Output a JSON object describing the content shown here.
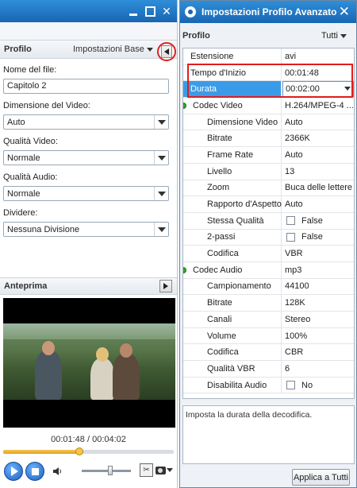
{
  "left_panel": {
    "profile_label": "Profilo",
    "profile_mode": "Impostazioni Base",
    "fields": {
      "filename_label": "Nome del file:",
      "filename_value": "Capitolo 2",
      "video_size_label": "Dimensione del Video:",
      "video_size_value": "Auto",
      "video_quality_label": "Qualità Video:",
      "video_quality_value": "Normale",
      "audio_quality_label": "Qualità Audio:",
      "audio_quality_value": "Normale",
      "split_label": "Dividere:",
      "split_value": "Nessuna Divisione"
    },
    "preview_label": "Anteprima",
    "timecode": "00:01:48 / 00:04:02",
    "progress_fraction": 0.447,
    "volume_fraction": 0.58
  },
  "dialog": {
    "title": "Impostazioni Profilo Avanzato",
    "profile_label": "Profilo",
    "profile_filter": "Tutti",
    "rows": [
      {
        "key": "Estensione",
        "value": "avi",
        "indent": 1
      },
      {
        "key": "Tempo d'Inizio",
        "value": "00:01:48",
        "indent": 1
      },
      {
        "key": "Durata",
        "value": "00:02:00",
        "indent": 1,
        "selected": true
      },
      {
        "key": "Codec Video",
        "value": "H.264/MPEG-4 ...",
        "indent": 0,
        "group": true
      },
      {
        "key": "Dimensione Video",
        "value": "Auto",
        "indent": 2
      },
      {
        "key": "Bitrate",
        "value": "2366K",
        "indent": 2
      },
      {
        "key": "Frame Rate",
        "value": "Auto",
        "indent": 2
      },
      {
        "key": "Livello",
        "value": "13",
        "indent": 2
      },
      {
        "key": "Zoom",
        "value": "Buca delle lettere",
        "indent": 2
      },
      {
        "key": "Rapporto d'Aspetto",
        "value": "Auto",
        "indent": 2
      },
      {
        "key": "Stessa Qualità",
        "value": "False",
        "indent": 2,
        "checkbox": true
      },
      {
        "key": "2-passi",
        "value": "False",
        "indent": 2,
        "checkbox": true
      },
      {
        "key": "Codifica",
        "value": "VBR",
        "indent": 2
      },
      {
        "key": "Codec Audio",
        "value": "mp3",
        "indent": 0,
        "group": true
      },
      {
        "key": "Campionamento",
        "value": "44100",
        "indent": 2
      },
      {
        "key": "Bitrate",
        "value": "128K",
        "indent": 2
      },
      {
        "key": "Canali",
        "value": "Stereo",
        "indent": 2
      },
      {
        "key": "Volume",
        "value": "100%",
        "indent": 2
      },
      {
        "key": "Codifica",
        "value": "CBR",
        "indent": 2
      },
      {
        "key": "Qualità VBR",
        "value": "6",
        "indent": 2
      },
      {
        "key": "Disabilita Audio",
        "value": "No",
        "indent": 2,
        "checkbox": true
      }
    ],
    "description": "Imposta la durata della decodifica.",
    "apply_all_label": "Applica a Tutti"
  },
  "colors": {
    "title_bar": "#1866b3",
    "selection": "#3a9ce8",
    "highlight_box": "#e01c1c",
    "group_dot": "#2aa82a",
    "seek_fill": "#e4a21f"
  }
}
